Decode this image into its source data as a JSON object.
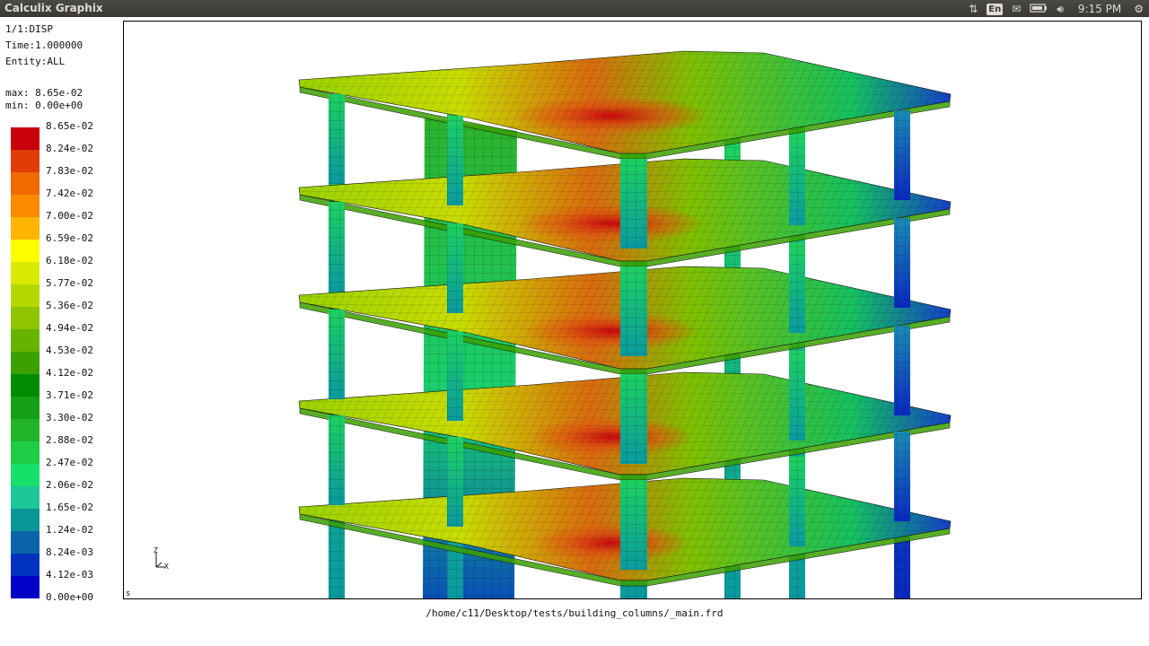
{
  "window": {
    "title": "Calculix Graphix"
  },
  "tray": {
    "network_icon": "up-down-arrows-icon",
    "keyboard_layout": "En",
    "mail_icon": "envelope-icon",
    "battery_icon": "battery-icon",
    "volume_icon": "speaker-icon",
    "time": "9:15 PM",
    "settings_icon": "gear-icon"
  },
  "result": {
    "step": "1/1:DISP",
    "time": "Time:1.000000",
    "entity": "Entity:ALL",
    "max": "max: 8.65e-02",
    "min": "min: 0.00e+00"
  },
  "legend": {
    "labels": [
      "8.65e-02",
      "8.24e-02",
      "7.83e-02",
      "7.42e-02",
      "7.00e-02",
      "6.59e-02",
      "6.18e-02",
      "5.77e-02",
      "5.36e-02",
      "4.94e-02",
      "4.53e-02",
      "4.12e-02",
      "3.71e-02",
      "3.30e-02",
      "2.88e-02",
      "2.47e-02",
      "2.06e-02",
      "1.65e-02",
      "1.24e-02",
      "8.24e-03",
      "4.12e-03",
      "0.00e+00"
    ],
    "colors": [
      "#c8000a",
      "#e03c05",
      "#f06a00",
      "#fa8a00",
      "#ffb400",
      "#ffff00",
      "#d8ea00",
      "#b4d800",
      "#8ec400",
      "#66b400",
      "#3ca000",
      "#008c00",
      "#14a014",
      "#22b428",
      "#1ecc46",
      "#14e06a",
      "#1ec896",
      "#0a9696",
      "#0a64aa",
      "#0032be",
      "#0000c8",
      "#3214dc",
      "#8c0af0"
    ]
  },
  "axes": {
    "z": "Z",
    "x": "X"
  },
  "viewport": {
    "corner_label": "s"
  },
  "file": {
    "path": "/home/c11/Desktop/tests/building_columns/_main.frd"
  }
}
